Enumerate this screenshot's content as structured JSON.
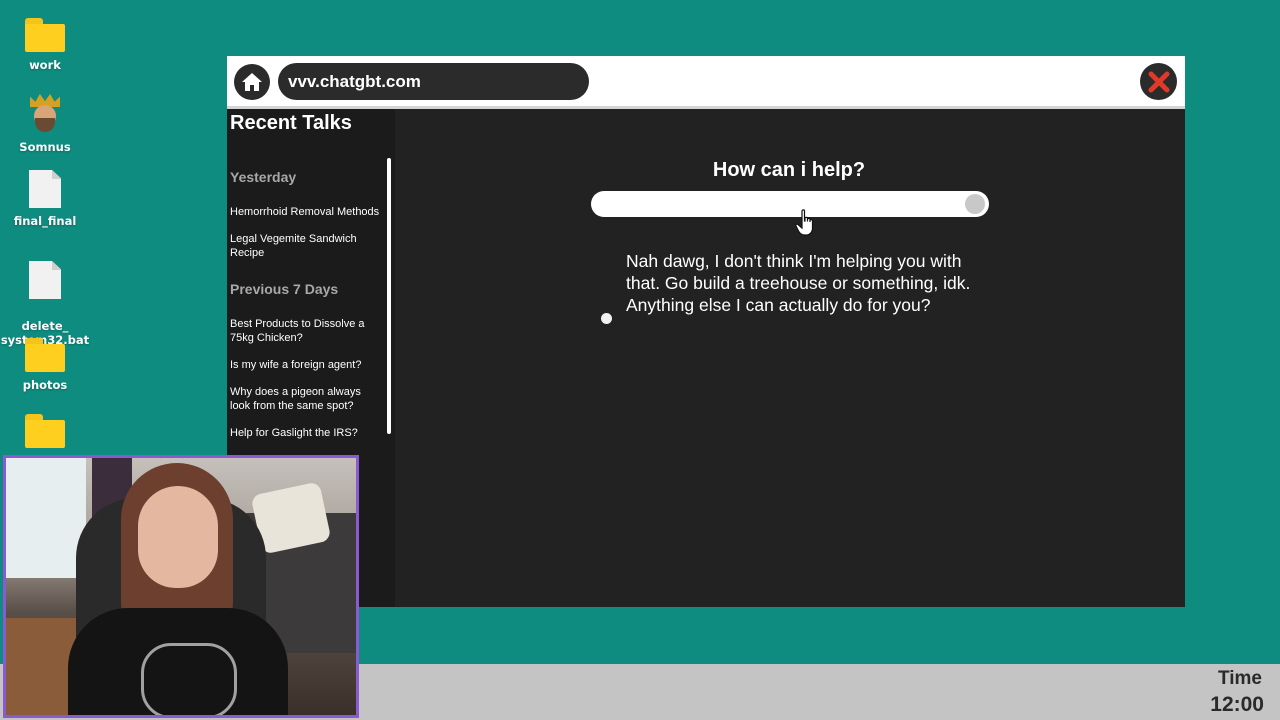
{
  "desktop": {
    "icons": [
      {
        "label": "work",
        "type": "folder"
      },
      {
        "label": "Somnus",
        "type": "app"
      },
      {
        "label": "final_final",
        "type": "file"
      },
      {
        "label": "delete_\nsystem32.bat",
        "type": "file"
      },
      {
        "label": "photos",
        "type": "folder"
      },
      {
        "label": "",
        "type": "folder"
      }
    ]
  },
  "browser": {
    "url": "vvv.chatgbt.com",
    "home_icon": "home-icon",
    "close_icon": "close-icon",
    "sidebar": {
      "title": "Recent Talks",
      "groups": [
        {
          "label": "Yesterday",
          "items": [
            "Hemorrhoid Removal Methods",
            "Legal Vegemite Sandwich Recipe"
          ]
        },
        {
          "label": "Previous 7 Days",
          "items": [
            "Best Products to Dissolve a 75kg Chicken?",
            "Is my wife a foreign agent?",
            "Why does a pigeon always look from the same spot?",
            "Help for Gaslight the IRS?"
          ]
        }
      ]
    },
    "main": {
      "prompt_title": "How can i help?",
      "search_value": "",
      "reply": "Nah dawg, I don't think I'm helping you with that. Go build a treehouse or something, idk. Anything else I can actually do for you?"
    }
  },
  "taskbar": {
    "time_label": "Time",
    "time_value": "12:00"
  },
  "colors": {
    "desktop": "#0f8c80",
    "window_bg": "#222222",
    "close_x": "#e0392a",
    "webcam_border": "#8a5bd0"
  }
}
